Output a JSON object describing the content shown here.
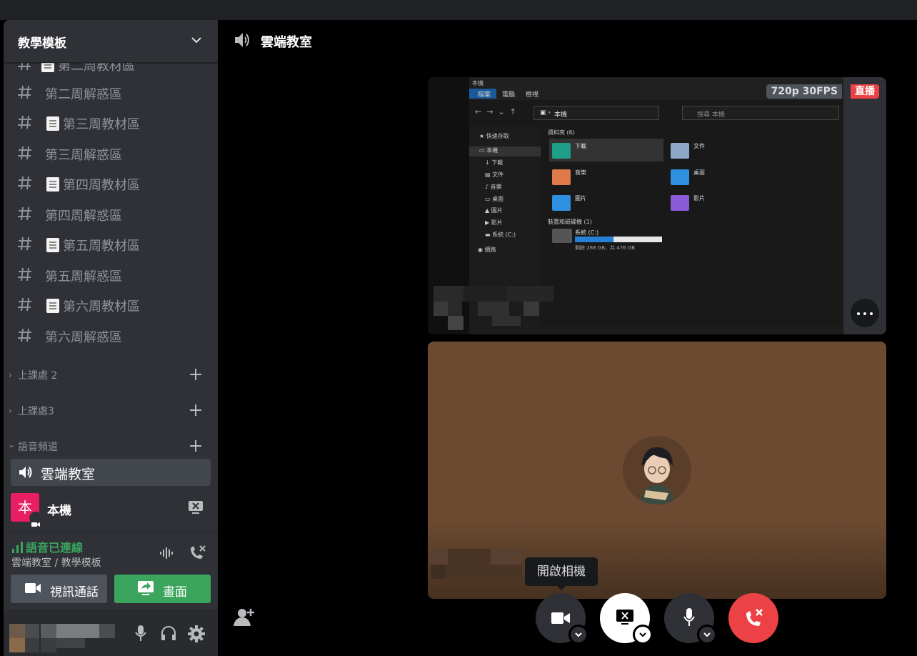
{
  "sidebar": {
    "guild_name": "教學模板",
    "channels": [
      {
        "type": "text",
        "label": "第二周教材區",
        "memo": true
      },
      {
        "type": "text",
        "label": "第二周解惑區",
        "memo": false
      },
      {
        "type": "text",
        "label": "第三周教材區",
        "memo": true
      },
      {
        "type": "text",
        "label": "第三周解惑區",
        "memo": false
      },
      {
        "type": "text",
        "label": "第四周教材區",
        "memo": true
      },
      {
        "type": "text",
        "label": "第四周解惑區",
        "memo": false
      },
      {
        "type": "text",
        "label": "第五周教材區",
        "memo": true
      },
      {
        "type": "text",
        "label": "第五周解惑區",
        "memo": false
      },
      {
        "type": "text",
        "label": "第六周教材區",
        "memo": true
      },
      {
        "type": "text",
        "label": "第六周解惑區",
        "memo": false
      }
    ],
    "categories": [
      "上課處 2",
      "上課處3",
      "語音頻道"
    ],
    "active_voice_channel": "雲端教室",
    "voice_member": {
      "name": "本機",
      "avatar_char": "本",
      "avatar_color": "#e91e63"
    }
  },
  "voice_panel": {
    "status": "語音已連線",
    "location": "雲端教室 / 教學模板",
    "video_button": "視訊通話",
    "screen_button": "畫面"
  },
  "main": {
    "channel_title": "雲端教室",
    "stream": {
      "resolution_badge": "720p 30FPS",
      "live_badge": "直播",
      "explorer": {
        "tabs": [
          "檔案",
          "電腦",
          "檢視"
        ],
        "address": "本機",
        "search_placeholder": "搜尋 本機",
        "nav_items": [
          "快速存取",
          "本機",
          "下載",
          "文件",
          "音樂",
          "桌面",
          "圖片",
          "影片",
          "系統 (C:)",
          "網路"
        ],
        "folders_header": "資料夾 (6)",
        "folders": [
          {
            "name": "下載",
            "color": "#1f9e8a"
          },
          {
            "name": "文件",
            "color": "#8ea6c8"
          },
          {
            "name": "音樂",
            "color": "#e07a4a"
          },
          {
            "name": "桌面",
            "color": "#2f8fe0"
          },
          {
            "name": "圖片",
            "color": "#2f8fe0"
          },
          {
            "name": "影片",
            "color": "#8a5ad8"
          }
        ],
        "drives_header": "裝置和磁碟機 (1)",
        "drive_name": "系統 (C:)",
        "drive_info": "剩餘 268 GB，共 476 GB",
        "drive_used_fraction": 0.44
      }
    },
    "tooltip": "開啟相機"
  },
  "colors": {
    "green": "#3ba55d",
    "red": "#ed4245",
    "sidebar_bg": "#2f3136",
    "accent_pink": "#e91e63"
  }
}
